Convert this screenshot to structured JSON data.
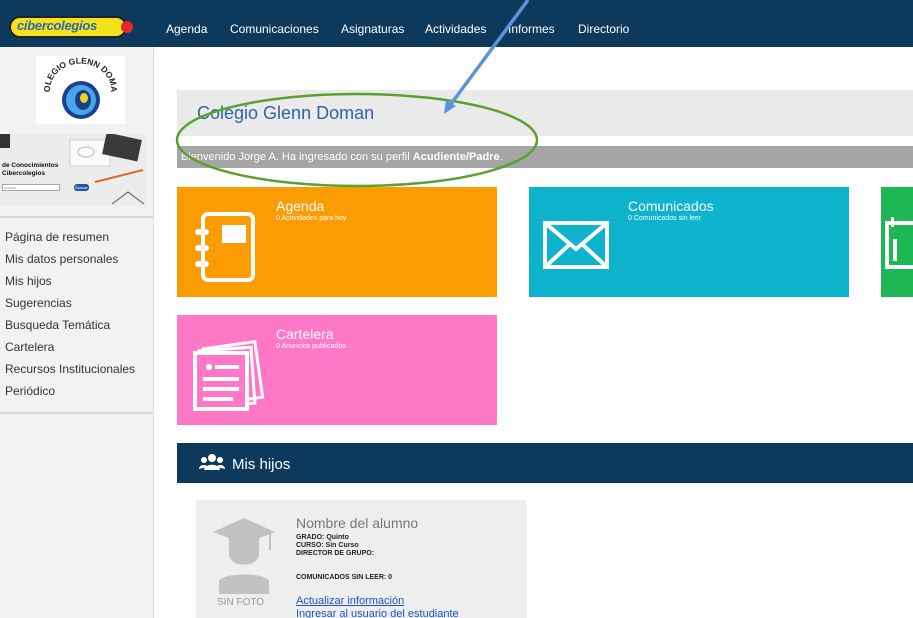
{
  "brand": {
    "name": "cibercolegios"
  },
  "nav": {
    "items": [
      {
        "label": "Agenda"
      },
      {
        "label": "Comunicaciones"
      },
      {
        "label": "Asignaturas"
      },
      {
        "label": "Actividades"
      },
      {
        "label": "Informes"
      },
      {
        "label": "Directorio"
      }
    ]
  },
  "sidebar": {
    "logo": {
      "text": "COLEGIO GLENN DOMAN"
    },
    "banner": {
      "text": "de Conocimientos Cibercolegios",
      "search_placeholder": "buscar",
      "search_button": "Buscar"
    },
    "menu": [
      {
        "label": "Página de resumen"
      },
      {
        "label": "Mis datos personales"
      },
      {
        "label": "Mis hijos"
      },
      {
        "label": "Sugerencias"
      },
      {
        "label": "Busqueda Temática"
      },
      {
        "label": "Cartelera"
      },
      {
        "label": "Recursos Institucionales"
      },
      {
        "label": "Periódico"
      }
    ]
  },
  "main": {
    "school_title": "Colegio Glenn Doman",
    "welcome": {
      "prefix": "Bienvenido Jorge A. Ha ingresado con su perfil ",
      "profile": "Acudiente/Padre",
      "suffix": "."
    },
    "tiles": [
      {
        "title": "Agenda",
        "subtitle": "0 Actividades para hoy",
        "color": "#fc9c03",
        "icon": "notebook-icon"
      },
      {
        "title": "Comunicados",
        "subtitle": "0 Comunicados sin leer",
        "color": "#0eb3ce",
        "icon": "envelope-icon"
      },
      {
        "title": "",
        "subtitle": "",
        "color": "#1db753",
        "icon": "calendar-icon"
      },
      {
        "title": "Cartelera",
        "subtitle": "0 Anuncios publicados",
        "color": "#ff78c7",
        "icon": "papers-icon"
      }
    ],
    "children_section": {
      "title": "Mis hijos",
      "icon": "users-icon"
    },
    "student_card": {
      "name": "Nombre del alumno",
      "grado": "GRADO: Quinto",
      "curso": "CURSO: Sin Curso",
      "director": "DIRECTOR DE GRUPO:",
      "comunicados": "COMUNICADOS SIN LEER: 0",
      "photo_label": "SIN FOTO",
      "link_update": "Actualizar información",
      "link_login": "Ingresar al usuario del estudiante"
    }
  },
  "colors": {
    "navbar": "#0d3a5c",
    "title_text": "#2d64a8",
    "annotation_ellipse": "#5aa033",
    "annotation_arrow": "#5b95d6"
  }
}
